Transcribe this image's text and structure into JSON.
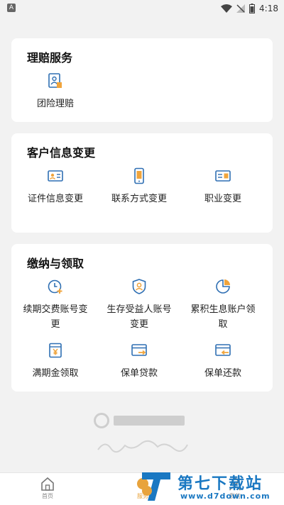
{
  "status_bar": {
    "left_icon": "A",
    "time": "4:18"
  },
  "claims": {
    "title": "理赔服务",
    "items": [
      {
        "label": "团险理赔",
        "icon": "photo-doc-icon"
      }
    ]
  },
  "customer_info": {
    "title": "客户信息变更",
    "items": [
      {
        "label": "证件信息变更",
        "icon": "id-card-icon"
      },
      {
        "label": "联系方式变更",
        "icon": "phone-icon"
      },
      {
        "label": "职业变更",
        "icon": "badge-icon"
      }
    ]
  },
  "payment": {
    "title": "缴纳与领取",
    "items": [
      {
        "label": "续期交费账号变更",
        "icon": "clock-plus-icon"
      },
      {
        "label": "生存受益人账号变更",
        "icon": "shield-person-icon"
      },
      {
        "label": "累积生息账户领取",
        "icon": "pie-icon"
      },
      {
        "label": "满期金领取",
        "icon": "yen-box-icon"
      },
      {
        "label": "保单贷款",
        "icon": "card-out-icon"
      },
      {
        "label": "保单还款",
        "icon": "card-in-icon"
      }
    ]
  },
  "bottom_nav": {
    "home_label": "首页",
    "service_label": "服务",
    "mine_label": "我的"
  },
  "brand": {
    "name": "第七下载站",
    "url": "www.d7down.com"
  },
  "colors": {
    "accent": "#e8a33c",
    "icon_blue": "#2f6fb3",
    "brand": "#1a78c2"
  }
}
